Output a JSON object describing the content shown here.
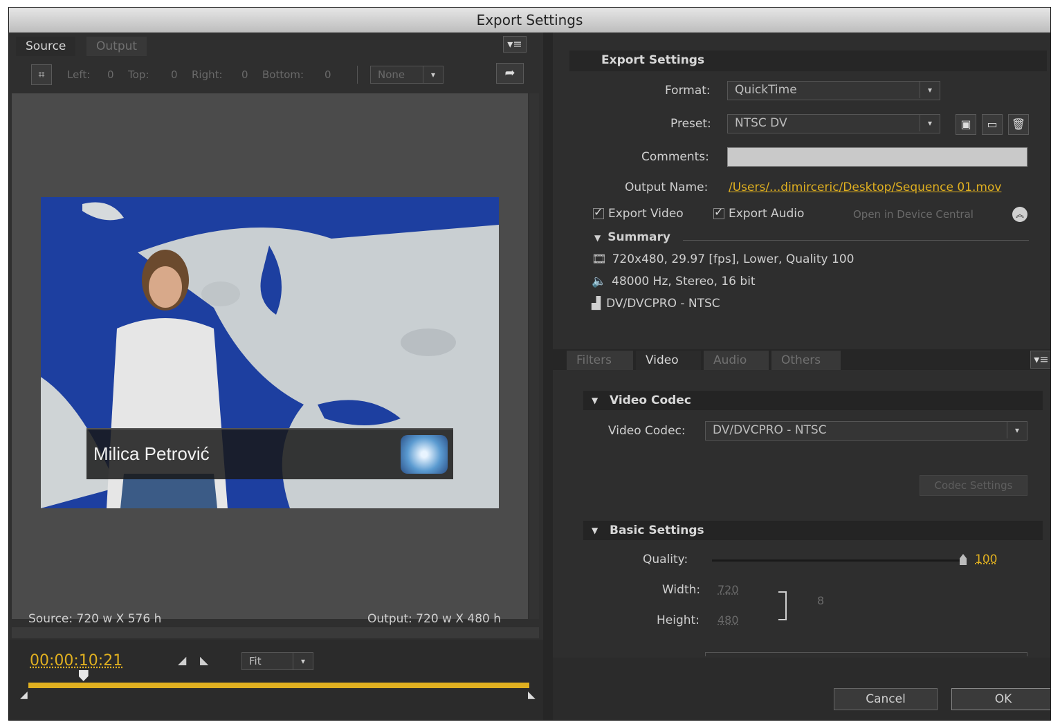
{
  "window": {
    "title": "Export Settings"
  },
  "left": {
    "tabs": [
      "Source",
      "Output"
    ],
    "crop": {
      "left_label": "Left:",
      "left_value": "0",
      "top_label": "Top:",
      "top_value": "0",
      "right_label": "Right:",
      "right_value": "0",
      "bottom_label": "Bottom:",
      "bottom_value": "0",
      "ratio": "None"
    },
    "video_caption": "Milica Petrović",
    "source_info": "Source: 720 w X 576 h",
    "output_info": "Output: 720 w X 480 h",
    "timecode": "00:00:10:21",
    "zoom": "Fit",
    "playhead_fraction": 0.11
  },
  "export": {
    "header": "Export Settings",
    "format_label": "Format:",
    "format_value": "QuickTime",
    "preset_label": "Preset:",
    "preset_value": "NTSC DV",
    "comments_label": "Comments:",
    "comments_value": "",
    "output_name_label": "Output Name:",
    "output_name_value": "/Users/...dimirceric/Desktop/Sequence 01.mov",
    "export_video": "Export Video",
    "export_audio": "Export Audio",
    "device_central": "Open in Device Central",
    "summary_label": "Summary",
    "summary_video": "720x480, 29.97 [fps], Lower, Quality 100",
    "summary_audio": "48000 Hz, Stereo, 16 bit",
    "summary_codec": "DV/DVCPRO - NTSC"
  },
  "tabs": [
    "Filters",
    "Video",
    "Audio",
    "Others"
  ],
  "video_codec": {
    "section": "Video Codec",
    "label": "Video Codec:",
    "value": "DV/DVCPRO - NTSC",
    "settings_button": "Codec Settings"
  },
  "basic": {
    "section": "Basic Settings",
    "quality_label": "Quality:",
    "quality_value": "100",
    "width_label": "Width:",
    "width_value": "720",
    "height_label": "Height:",
    "height_value": "480"
  },
  "buttons": {
    "cancel": "Cancel",
    "ok": "OK"
  }
}
